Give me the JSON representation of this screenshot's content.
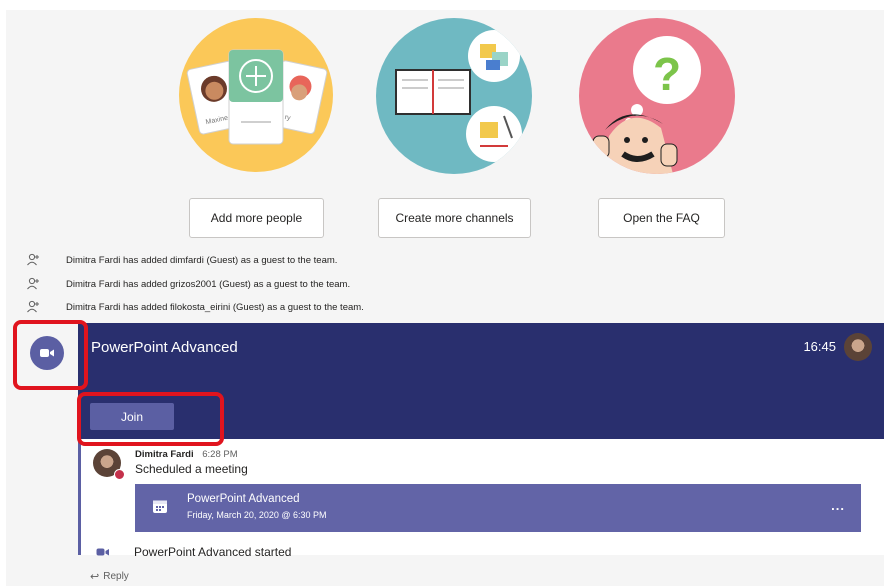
{
  "actions": {
    "add_people": "Add more people",
    "create_channels": "Create more channels",
    "open_faq": "Open the FAQ"
  },
  "illustration_text": {
    "card_left_name": "Maxine",
    "card_right_name": "ry"
  },
  "system_messages": [
    "Dimitra Fardi has added dimfardi (Guest) as a guest to the team.",
    "Dimitra Fardi has added grizos2001 (Guest) as a guest to the team.",
    "Dimitra Fardi has added filokosta_eirini (Guest) as a guest to the team."
  ],
  "meeting": {
    "title": "PowerPoint Advanced",
    "time": "16:45",
    "join_label": "Join"
  },
  "post": {
    "author": "Dimitra Fardi",
    "time": "6:28 PM",
    "text": "Scheduled a meeting",
    "card": {
      "title": "PowerPoint Advanced",
      "subtitle": "Friday, March 20, 2020 @ 6:30 PM",
      "more": "..."
    }
  },
  "started": {
    "text": "PowerPoint Advanced started"
  },
  "reply": {
    "label": "Reply",
    "arrow": "↩"
  },
  "colors": {
    "meeting_header": "#292f6e",
    "join_button": "#5b5fa3",
    "card": "#6264a7",
    "highlight": "#e0141e",
    "illus_yellow": "#fbc858",
    "illus_teal": "#6fb9c2",
    "illus_pink": "#ea7a8c"
  }
}
